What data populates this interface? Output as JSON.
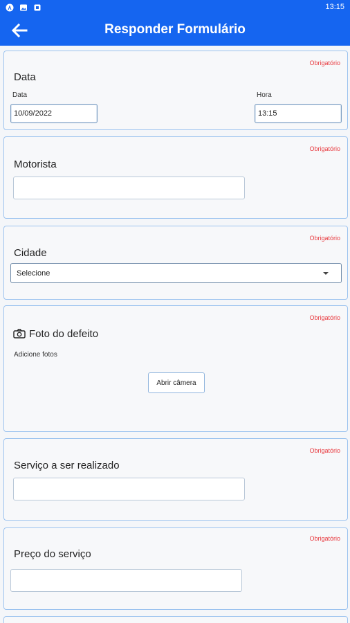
{
  "status_bar": {
    "time": "13:15",
    "icons": [
      "assistant-icon",
      "image-icon",
      "notification-icon"
    ]
  },
  "app_bar": {
    "title": "Responder Formulário",
    "back_icon": "arrow-left-icon"
  },
  "required_label": "Obrigatório",
  "fields": {
    "date": {
      "label": "Data",
      "date_label": "Data",
      "date_value": "10/09/2022",
      "time_label": "Hora",
      "time_value": "13:15"
    },
    "driver": {
      "label": "Motorista",
      "value": ""
    },
    "city": {
      "label": "Cidade",
      "selected": "Selecione"
    },
    "photo": {
      "label": "Foto do defeito",
      "hint": "Adicione fotos",
      "button": "Abrir câmera",
      "icon": "camera-icon"
    },
    "service": {
      "label": "Serviço a ser realizado",
      "value": ""
    },
    "price": {
      "label": "Preço do serviço",
      "value": ""
    }
  },
  "colors": {
    "primary": "#1565f0",
    "required": "#e8393e",
    "card_border": "#9cc3ef",
    "background": "#f4f6f9"
  }
}
